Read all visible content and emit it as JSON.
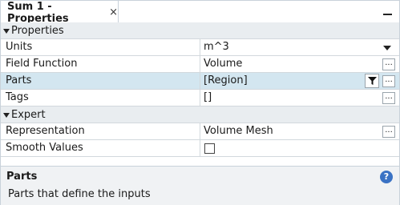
{
  "window": {
    "tab_title": "Sum 1 - Properties",
    "close_glyph": "×"
  },
  "categories": {
    "properties": "Properties",
    "expert": "Expert"
  },
  "properties": {
    "units": {
      "label": "Units",
      "value": "m^3"
    },
    "field_function": {
      "label": "Field Function",
      "value": "Volume",
      "button": "..."
    },
    "parts": {
      "label": "Parts",
      "value": "[Region]",
      "button": "..."
    },
    "tags": {
      "label": "Tags",
      "value": "[]",
      "button": "..."
    }
  },
  "expert": {
    "representation": {
      "label": "Representation",
      "value": "Volume Mesh",
      "button": "..."
    },
    "smooth_values": {
      "label": "Smooth Values",
      "checked": false
    }
  },
  "help": {
    "title": "Parts",
    "description": "Parts that define the inputs",
    "icon_glyph": "?"
  },
  "colors": {
    "selected_row": "#d3e6f0",
    "category_row": "#e9edf0",
    "help_bg": "#f0f2f4",
    "help_icon": "#3a72c4"
  }
}
